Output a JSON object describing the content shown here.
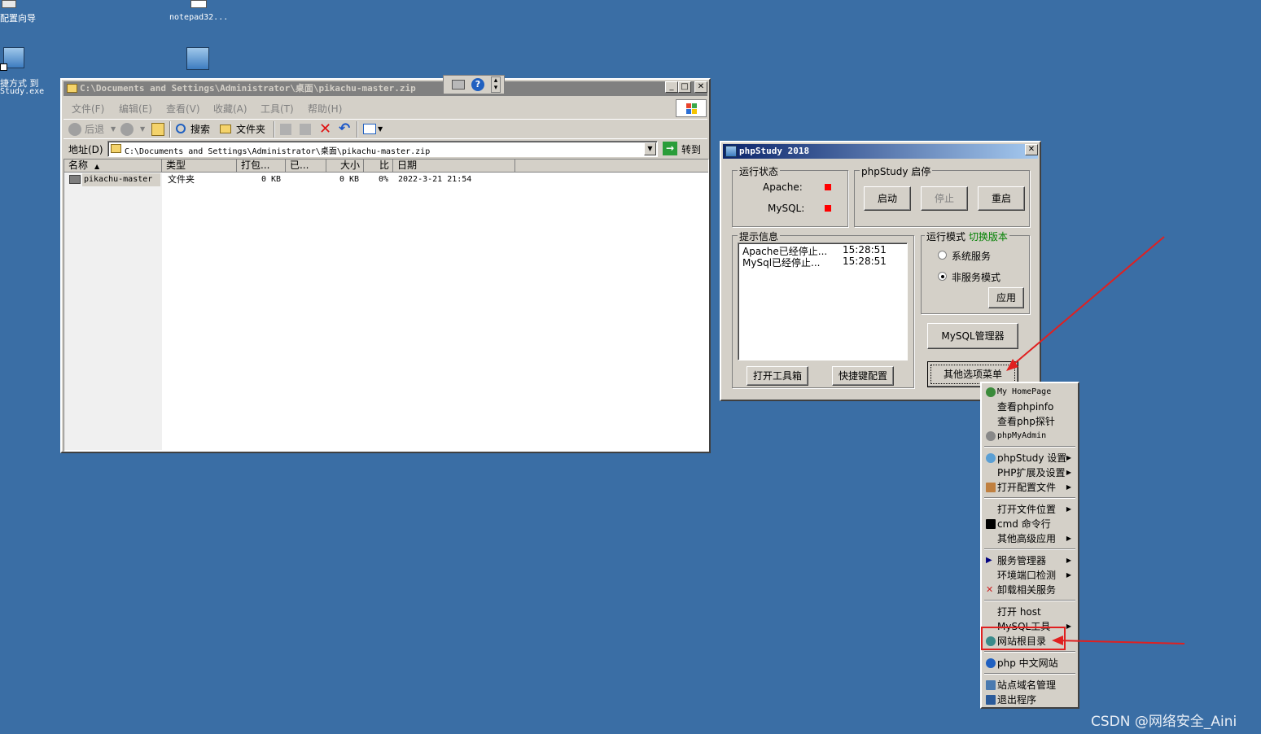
{
  "desktop": {
    "icons": [
      {
        "label": "配置向导"
      },
      {
        "label": "notepad32..."
      },
      {
        "label_line1": "捷方式 到",
        "label_line2": "Study.exe"
      }
    ]
  },
  "explorer": {
    "title": "C:\\Documents and Settings\\Administrator\\桌面\\pikachu-master.zip",
    "menu": [
      "文件(F)",
      "编辑(E)",
      "查看(V)",
      "收藏(A)",
      "工具(T)",
      "帮助(H)"
    ],
    "toolbar": {
      "back": "后退",
      "search": "搜索",
      "folders": "文件夹"
    },
    "address": {
      "label": "地址(D)",
      "value": "C:\\Documents and Settings\\Administrator\\桌面\\pikachu-master.zip",
      "go": "转到"
    },
    "columns": [
      "名称",
      "类型",
      "打包...",
      "已...",
      "大小",
      "比",
      "日期"
    ],
    "rows": [
      {
        "name": "pikachu-master",
        "type": "文件夹",
        "packed": "0 KB",
        "size": "0 KB",
        "ratio": "0%",
        "date": "2022-3-21 21:54"
      }
    ]
  },
  "phpstudy": {
    "title": "phpStudy 2018",
    "status_group": "运行状态",
    "apache_label": "Apache:",
    "mysql_label": "MySQL:",
    "control_group": "phpStudy 启停",
    "start": "启动",
    "stop": "停止",
    "restart": "重启",
    "info_group": "提示信息",
    "logs": [
      {
        "msg": "Apache已经停止...",
        "time": "15:28:51"
      },
      {
        "msg": "MySql已经停止...",
        "time": "15:28:51"
      }
    ],
    "mode_group": "运行模式",
    "switch_version": "切换版本",
    "mode_system": "系统服务",
    "mode_nonservice": "非服务模式",
    "apply": "应用",
    "mysql_manager": "MySQL管理器",
    "open_toolbox": "打开工具箱",
    "hotkey_config": "快捷键配置",
    "other_menu": "其他选项菜单",
    "status_color": "#ff0000",
    "version_color": "#008000"
  },
  "context_menu": {
    "items": [
      "My HomePage",
      "查看phpinfo",
      "查看php探针",
      "phpMyAdmin",
      "phpStudy 设置",
      "PHP扩展及设置",
      "打开配置文件",
      "打开文件位置",
      "cmd 命令行",
      "其他高级应用",
      "服务管理器",
      "环境端口检测",
      "卸载相关服务",
      "打开 host",
      "MySQL工具",
      "网站根目录",
      "php 中文网站",
      "站点域名管理",
      "退出程序"
    ]
  },
  "watermark": "CSDN @网络安全_Aini",
  "colors": {
    "desktop": "#3a6ea5",
    "titlebar": "#0a246a",
    "highlight_box": "#e02020"
  }
}
